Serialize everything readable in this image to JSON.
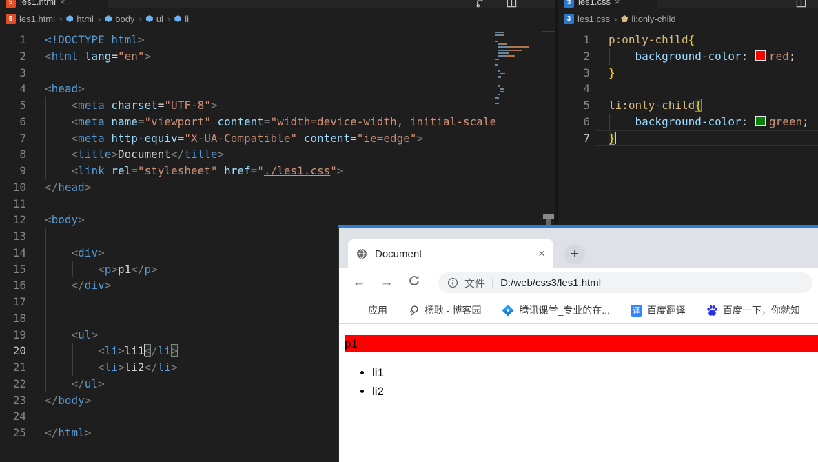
{
  "vscode": {
    "left": {
      "tab_label": "les1.html",
      "breadcrumb": {
        "file": "les1.html",
        "segments": [
          "html",
          "body",
          "ul",
          "li"
        ]
      },
      "lines": [
        {
          "n": 1,
          "t": [
            [
              "k",
              "<!DOCTYPE"
            ],
            [
              "w",
              " "
            ],
            [
              "k",
              "html"
            ],
            [
              "p",
              ">"
            ]
          ]
        },
        {
          "n": 2,
          "t": [
            [
              "p",
              "<"
            ],
            [
              "k",
              "html"
            ],
            [
              "w",
              " "
            ],
            [
              "a",
              "lang"
            ],
            [
              "o",
              "="
            ],
            [
              "s",
              "\"en\""
            ],
            [
              "p",
              ">"
            ]
          ]
        },
        {
          "n": 3,
          "t": []
        },
        {
          "n": 4,
          "t": [
            [
              "p",
              "<"
            ],
            [
              "k",
              "head"
            ],
            [
              "p",
              ">"
            ]
          ]
        },
        {
          "n": 5,
          "g": [
            0
          ],
          "t": [
            [
              "w",
              "    "
            ],
            [
              "p",
              "<"
            ],
            [
              "k",
              "meta"
            ],
            [
              "w",
              " "
            ],
            [
              "a",
              "charset"
            ],
            [
              "o",
              "="
            ],
            [
              "s",
              "\"UTF-8\""
            ],
            [
              "p",
              ">"
            ]
          ]
        },
        {
          "n": 6,
          "g": [
            0
          ],
          "t": [
            [
              "w",
              "    "
            ],
            [
              "p",
              "<"
            ],
            [
              "k",
              "meta"
            ],
            [
              "w",
              " "
            ],
            [
              "a",
              "name"
            ],
            [
              "o",
              "="
            ],
            [
              "s",
              "\"viewport\""
            ],
            [
              "w",
              " "
            ],
            [
              "a",
              "content"
            ],
            [
              "o",
              "="
            ],
            [
              "s",
              "\"width=device-width, initial-scale"
            ]
          ]
        },
        {
          "n": 7,
          "g": [
            0
          ],
          "t": [
            [
              "w",
              "    "
            ],
            [
              "p",
              "<"
            ],
            [
              "k",
              "meta"
            ],
            [
              "w",
              " "
            ],
            [
              "a",
              "http-equiv"
            ],
            [
              "o",
              "="
            ],
            [
              "s",
              "\"X-UA-Compatible\""
            ],
            [
              "w",
              " "
            ],
            [
              "a",
              "content"
            ],
            [
              "o",
              "="
            ],
            [
              "s",
              "\"ie=edge\""
            ],
            [
              "p",
              ">"
            ]
          ]
        },
        {
          "n": 8,
          "g": [
            0
          ],
          "t": [
            [
              "w",
              "    "
            ],
            [
              "p",
              "<"
            ],
            [
              "k",
              "title"
            ],
            [
              "p",
              ">"
            ],
            [
              "w",
              "Document"
            ],
            [
              "p",
              "</"
            ],
            [
              "k",
              "title"
            ],
            [
              "p",
              ">"
            ]
          ]
        },
        {
          "n": 9,
          "g": [
            0
          ],
          "t": [
            [
              "w",
              "    "
            ],
            [
              "p",
              "<"
            ],
            [
              "k",
              "link"
            ],
            [
              "w",
              " "
            ],
            [
              "a",
              "rel"
            ],
            [
              "o",
              "="
            ],
            [
              "s",
              "\"stylesheet\""
            ],
            [
              "w",
              " "
            ],
            [
              "a",
              "href"
            ],
            [
              "o",
              "="
            ],
            [
              "s",
              "\""
            ],
            [
              "u",
              "./les1.css"
            ],
            [
              "s",
              "\""
            ],
            [
              "p",
              ">"
            ]
          ]
        },
        {
          "n": 10,
          "t": [
            [
              "p",
              "</"
            ],
            [
              "k",
              "head"
            ],
            [
              "p",
              ">"
            ]
          ]
        },
        {
          "n": 11,
          "t": []
        },
        {
          "n": 12,
          "t": [
            [
              "p",
              "<"
            ],
            [
              "k",
              "body"
            ],
            [
              "p",
              ">"
            ]
          ]
        },
        {
          "n": 13,
          "g": [
            0
          ],
          "t": []
        },
        {
          "n": 14,
          "g": [
            0
          ],
          "t": [
            [
              "w",
              "    "
            ],
            [
              "p",
              "<"
            ],
            [
              "k",
              "div"
            ],
            [
              "p",
              ">"
            ]
          ]
        },
        {
          "n": 15,
          "g": [
            0,
            1
          ],
          "t": [
            [
              "w",
              "        "
            ],
            [
              "p",
              "<"
            ],
            [
              "k",
              "p"
            ],
            [
              "p",
              ">"
            ],
            [
              "w",
              "p1"
            ],
            [
              "p",
              "</"
            ],
            [
              "k",
              "p"
            ],
            [
              "p",
              ">"
            ]
          ]
        },
        {
          "n": 16,
          "g": [
            0
          ],
          "t": [
            [
              "w",
              "    "
            ],
            [
              "p",
              "</"
            ],
            [
              "k",
              "div"
            ],
            [
              "p",
              ">"
            ]
          ]
        },
        {
          "n": 17,
          "g": [
            0
          ],
          "t": []
        },
        {
          "n": 18,
          "g": [
            0
          ],
          "t": []
        },
        {
          "n": 19,
          "g": [
            0
          ],
          "t": [
            [
              "w",
              "    "
            ],
            [
              "p",
              "<"
            ],
            [
              "k",
              "ul"
            ],
            [
              "p",
              ">"
            ]
          ]
        },
        {
          "n": 20,
          "cur": true,
          "g": [
            0,
            1
          ],
          "t": [
            [
              "w",
              "        "
            ],
            [
              "p",
              "<"
            ],
            [
              "k",
              "li"
            ],
            [
              "p",
              ">"
            ],
            [
              "w",
              "li1"
            ],
            [
              "cursor",
              ""
            ],
            [
              "p m",
              "<"
            ],
            [
              "p",
              "/"
            ],
            [
              "k",
              "li"
            ],
            [
              "p m",
              ">"
            ]
          ]
        },
        {
          "n": 21,
          "g": [
            0,
            1
          ],
          "t": [
            [
              "w",
              "        "
            ],
            [
              "p",
              "<"
            ],
            [
              "k",
              "li"
            ],
            [
              "p",
              ">"
            ],
            [
              "w",
              "li2"
            ],
            [
              "p",
              "</"
            ],
            [
              "k",
              "li"
            ],
            [
              "p",
              ">"
            ]
          ]
        },
        {
          "n": 22,
          "g": [
            0
          ],
          "t": [
            [
              "w",
              "    "
            ],
            [
              "p",
              "</"
            ],
            [
              "k",
              "ul"
            ],
            [
              "p",
              ">"
            ]
          ]
        },
        {
          "n": 23,
          "t": [
            [
              "p",
              "</"
            ],
            [
              "k",
              "body"
            ],
            [
              "p",
              ">"
            ]
          ]
        },
        {
          "n": 24,
          "t": []
        },
        {
          "n": 25,
          "t": [
            [
              "p",
              "</"
            ],
            [
              "k",
              "html"
            ],
            [
              "p",
              ">"
            ]
          ]
        }
      ]
    },
    "right": {
      "tab_label": "les1.css",
      "breadcrumb": {
        "file": "les1.css",
        "symbol": "li:only-child"
      },
      "lines": [
        {
          "n": 1,
          "t": [
            [
              "sel",
              "p:only-child"
            ],
            [
              "brace",
              "{"
            ]
          ]
        },
        {
          "n": 2,
          "g": [
            0
          ],
          "t": [
            [
              "w",
              "    "
            ],
            [
              "prop",
              "background-color"
            ],
            [
              "w",
              ": "
            ],
            [
              "sw-red",
              ""
            ],
            [
              "val",
              "red"
            ],
            [
              "w",
              ";"
            ]
          ]
        },
        {
          "n": 3,
          "t": [
            [
              "brace",
              "}"
            ]
          ]
        },
        {
          "n": 4,
          "t": []
        },
        {
          "n": 5,
          "t": [
            [
              "sel",
              "li:only-child"
            ],
            [
              "brace m",
              "{"
            ]
          ]
        },
        {
          "n": 6,
          "g": [
            0
          ],
          "t": [
            [
              "w",
              "    "
            ],
            [
              "prop",
              "background-color"
            ],
            [
              "w",
              ": "
            ],
            [
              "sw-green",
              ""
            ],
            [
              "val",
              "green"
            ],
            [
              "w",
              ";"
            ]
          ]
        },
        {
          "n": 7,
          "cur": true,
          "t": [
            [
              "brace m",
              "}"
            ],
            [
              "cursor",
              ""
            ]
          ]
        }
      ]
    },
    "ui": {
      "close": "×",
      "chevron": "›"
    }
  },
  "browser": {
    "tab_title": "Document",
    "tab_close": "×",
    "new_tab": "+",
    "nav": {
      "back": "←",
      "forward": "→"
    },
    "address": {
      "scheme": "文件",
      "divider": "|",
      "url": "D:/web/css3/les1.html"
    },
    "bookmarks": [
      {
        "label": "应用"
      },
      {
        "label": "杨耿 - 博客园"
      },
      {
        "label": "腾讯课堂_专业的在..."
      },
      {
        "label": "百度翻译",
        "badge": "译"
      },
      {
        "label": "百度一下，你就知"
      }
    ],
    "page": {
      "paragraph": "p1",
      "paragraph_bg": "#ff0000",
      "items": [
        "li1",
        "li2"
      ]
    }
  },
  "colors": {
    "window_accent": "#2e7cd6",
    "red_value": "red",
    "green_value": "green"
  }
}
